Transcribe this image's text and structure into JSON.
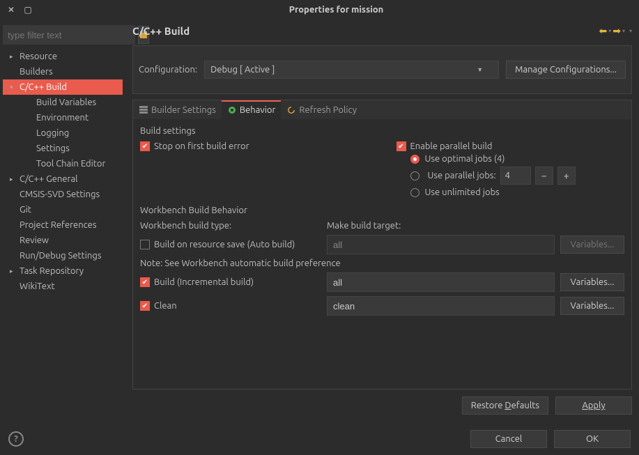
{
  "window": {
    "title": "Properties for mission"
  },
  "filter": {
    "placeholder": "type filter text"
  },
  "tree": [
    {
      "label": "Resource",
      "indent": 1,
      "expand": "▸"
    },
    {
      "label": "Builders",
      "indent": 1,
      "expand": ""
    },
    {
      "label": "C/C++ Build",
      "indent": 1,
      "expand": "▾",
      "selected": true
    },
    {
      "label": "Build Variables",
      "indent": 2,
      "expand": ""
    },
    {
      "label": "Environment",
      "indent": 2,
      "expand": ""
    },
    {
      "label": "Logging",
      "indent": 2,
      "expand": ""
    },
    {
      "label": "Settings",
      "indent": 2,
      "expand": ""
    },
    {
      "label": "Tool Chain Editor",
      "indent": 2,
      "expand": ""
    },
    {
      "label": "C/C++ General",
      "indent": 1,
      "expand": "▸"
    },
    {
      "label": "CMSIS-SVD Settings",
      "indent": 1,
      "expand": ""
    },
    {
      "label": "Git",
      "indent": 1,
      "expand": ""
    },
    {
      "label": "Project References",
      "indent": 1,
      "expand": ""
    },
    {
      "label": "Review",
      "indent": 1,
      "expand": ""
    },
    {
      "label": "Run/Debug Settings",
      "indent": 1,
      "expand": ""
    },
    {
      "label": "Task Repository",
      "indent": 1,
      "expand": "▸"
    },
    {
      "label": "WikiText",
      "indent": 1,
      "expand": ""
    }
  ],
  "page": {
    "title": "C/C++ Build",
    "config_label": "Configuration:",
    "config_value": "Debug  [ Active ]",
    "manage_btn": "Manage Configurations..."
  },
  "tabs": {
    "builder": "Builder Settings",
    "behavior": "Behavior",
    "refresh": "Refresh Policy"
  },
  "build_settings": {
    "title": "Build settings",
    "stop_label": "Stop on first build error",
    "parallel_label": "Enable parallel build",
    "opt_label": "Use optimal jobs (4)",
    "par_jobs_label": "Use parallel jobs:",
    "par_jobs_value": "4",
    "unlimited_label": "Use unlimited jobs"
  },
  "workbench": {
    "title": "Workbench Build Behavior",
    "type_label": "Workbench build type:",
    "target_label": "Make build target:",
    "auto_label": "Build on resource save (Auto build)",
    "auto_target": "all",
    "note": "Note: See Workbench automatic build preference",
    "inc_label": "Build (Incremental build)",
    "inc_target": "all",
    "clean_label": "Clean",
    "clean_target": "clean",
    "vars_btn": "Variables..."
  },
  "footer": {
    "restore": "Restore Defaults",
    "apply": "Apply",
    "cancel": "Cancel",
    "ok": "OK"
  }
}
